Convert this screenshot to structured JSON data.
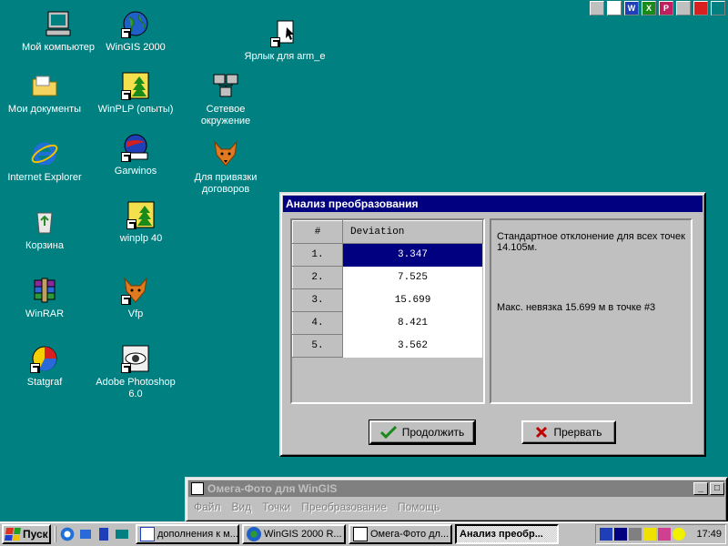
{
  "desktop": {
    "icons": [
      {
        "label": "Мой компьютер"
      },
      {
        "label": "WinGIS  2000"
      },
      {
        "label": "Ярлык для arm_e"
      },
      {
        "label": "Мои документы"
      },
      {
        "label": "WinPLP (опыты)"
      },
      {
        "label": "Сетевое окружение"
      },
      {
        "label": "Internet Explorer"
      },
      {
        "label": "Garwinos"
      },
      {
        "label": "Для привязки договоров"
      },
      {
        "label": "Корзина"
      },
      {
        "label": "winplp 40"
      },
      {
        "label": "WinRAR"
      },
      {
        "label": "Vfp"
      },
      {
        "label": "Statgraf"
      },
      {
        "label": "Adobe Photoshop 6.0"
      }
    ]
  },
  "dialog": {
    "title": "Анализ преобразования",
    "grid": {
      "headers": [
        "#",
        "Deviation"
      ],
      "rows": [
        {
          "num": "1.",
          "value": "3.347"
        },
        {
          "num": "2.",
          "value": "7.525"
        },
        {
          "num": "3.",
          "value": "15.699"
        },
        {
          "num": "4.",
          "value": "8.421"
        },
        {
          "num": "5.",
          "value": "3.562"
        }
      ],
      "selected_row": 1
    },
    "info": {
      "std_text": "Стандартное отклонение для всех точек 14.105м.",
      "max_text": "Макс. невязка 15.699 м в точке #3"
    },
    "buttons": {
      "continue": "Продолжить",
      "abort": "Прервать"
    }
  },
  "omega_window": {
    "title": "Омега-Фото для WinGIS",
    "menu": [
      "Файл",
      "Вид",
      "Точки",
      "Преобразование",
      "Помощь"
    ]
  },
  "taskbar": {
    "start": "Пуск",
    "tasks": [
      {
        "label": "дополнения к м..."
      },
      {
        "label": "WinGIS 2000 R..."
      },
      {
        "label": "Омега-Фото дл..."
      },
      {
        "label": "Анализ преобр..."
      }
    ],
    "clock": "17:49"
  },
  "colors": {
    "desktop": "#008080",
    "title_active": "#000080",
    "title_inactive": "#808080",
    "face": "#c0c0c0",
    "selection": "#000080"
  }
}
